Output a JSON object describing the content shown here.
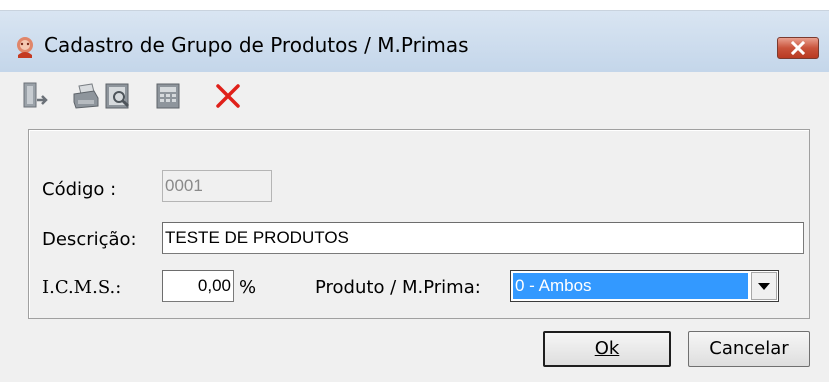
{
  "window": {
    "title": "Cadastro de Grupo de Produtos / M.Primas"
  },
  "toolbar": {
    "icons": [
      "exit-icon",
      "print-icon",
      "preview-icon",
      "calculator-icon",
      "delete-icon"
    ]
  },
  "form": {
    "codigo_label": "Código :",
    "codigo_value": "0001",
    "descricao_label": "Descrição:",
    "descricao_value": "TESTE DE PRODUTOS",
    "icms_label": "I.C.M.S.:",
    "icms_value": "0,00",
    "icms_unit": "%",
    "produto_label": "Produto / M.Prima:",
    "produto_selected": "0 - Ambos"
  },
  "buttons": {
    "ok": "Ok",
    "cancel": "Cancelar"
  },
  "colors": {
    "selection": "#3399ff",
    "close_button": "#c9533b",
    "delete_icon": "#e0201a"
  }
}
